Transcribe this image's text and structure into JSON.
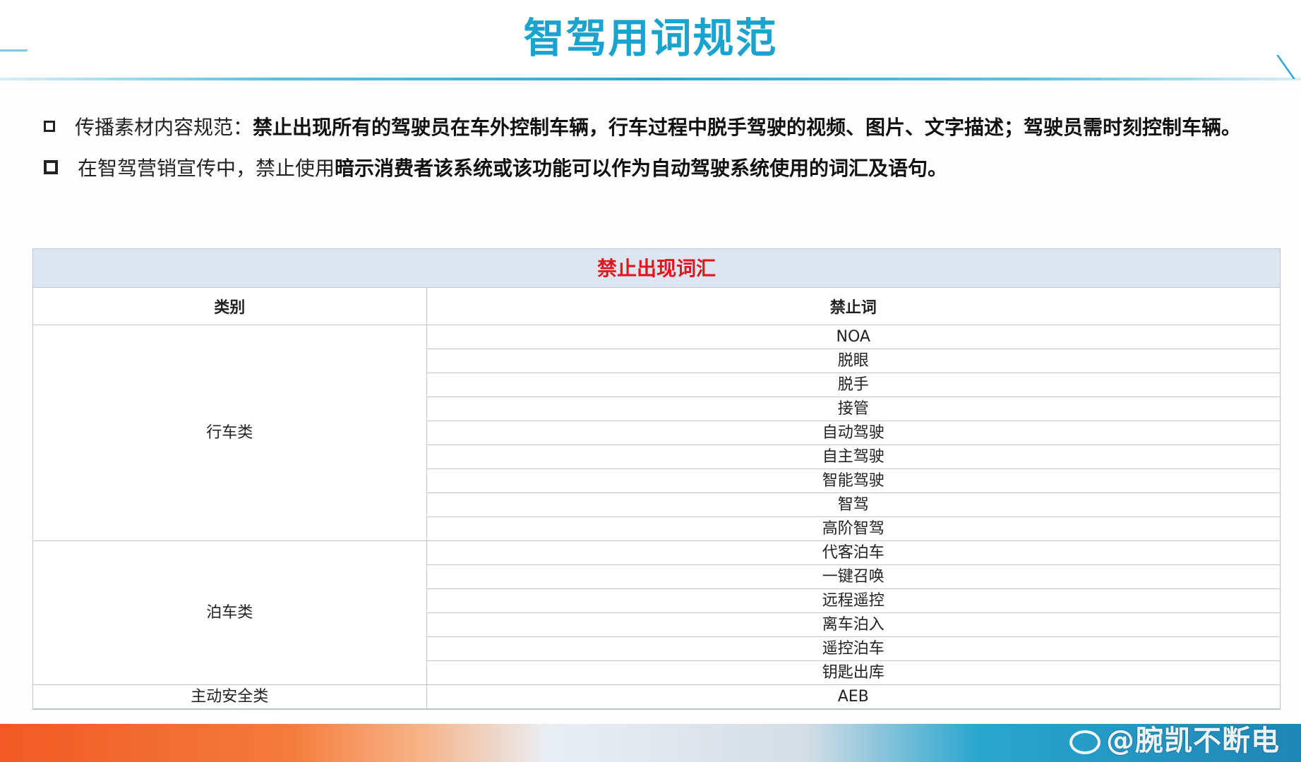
{
  "title": "智驾用词规范",
  "bullets": [
    {
      "lead": "传播素材内容规范：",
      "emphasis": "禁止出现所有的驾驶员在车外控制车辆，行车过程中脱手驾驶的视频、图片、文字描述；驾驶员需时刻控制车辆。"
    },
    {
      "lead": "在智驾营销宣传中，禁止使用",
      "emphasis": "暗示消费者该系统或该功能可以作为自动驾驶系统使用的词汇及语句。"
    }
  ],
  "table": {
    "title": "禁止出现词汇",
    "headers": [
      "类别",
      "禁止词"
    ],
    "groups": [
      {
        "category": "行车类",
        "words": [
          "NOA",
          "脱眼",
          "脱手",
          "接管",
          "自动驾驶",
          "自主驾驶",
          "智能驾驶",
          "智驾",
          "高阶智驾"
        ]
      },
      {
        "category": "泊车类",
        "words": [
          "代客泊车",
          "一键召唤",
          "远程遥控",
          "离车泊入",
          "遥控泊车",
          "钥匙出库"
        ]
      },
      {
        "category": "主动安全类",
        "words": [
          "AEB"
        ]
      }
    ]
  },
  "watermark": "@腕凯不断电"
}
